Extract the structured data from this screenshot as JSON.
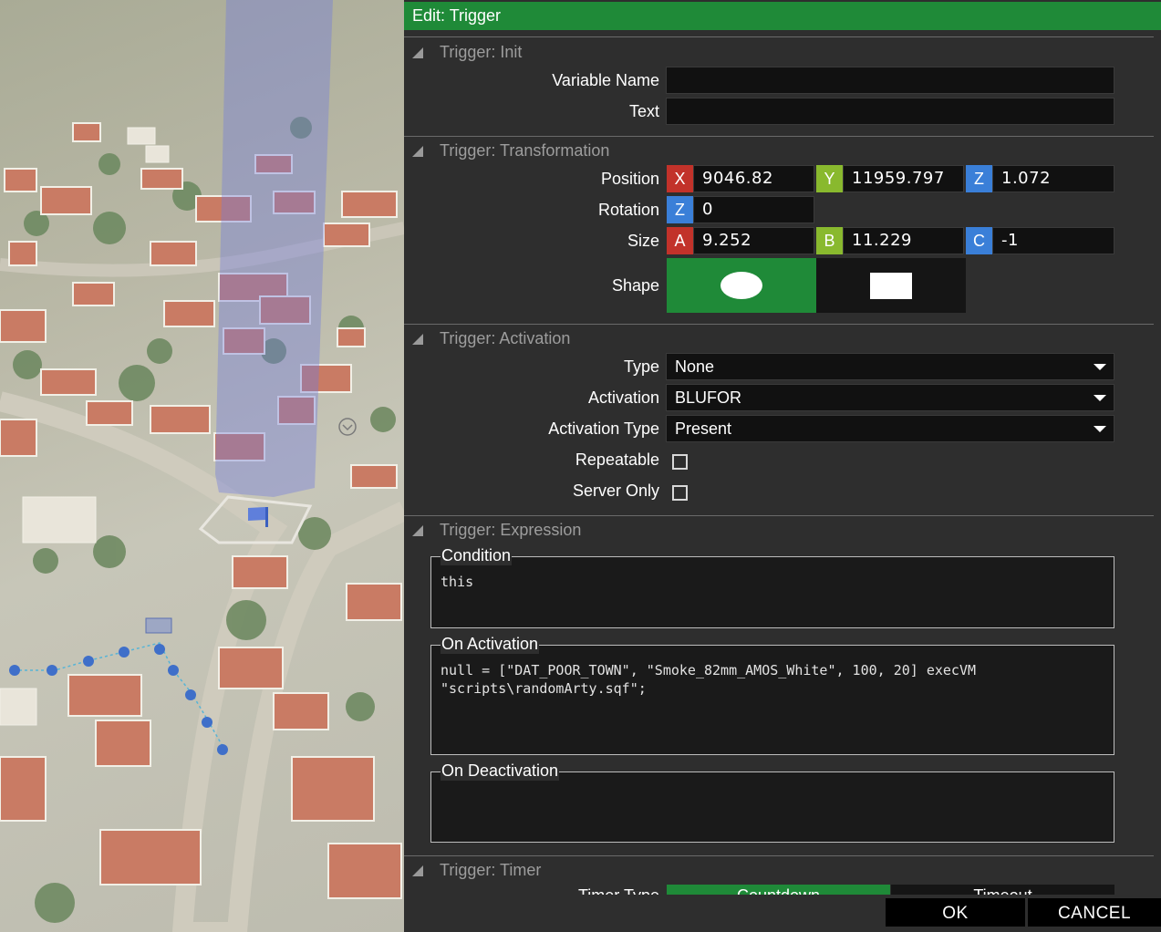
{
  "dialog": {
    "title": "Edit: Trigger"
  },
  "sections": {
    "init": {
      "title": "Trigger: Init",
      "variable_name_label": "Variable Name",
      "variable_name_value": "",
      "text_label": "Text",
      "text_value": ""
    },
    "transformation": {
      "title": "Trigger: Transformation",
      "position_label": "Position",
      "position": {
        "x_tag": "X",
        "x": "9046.82",
        "y_tag": "Y",
        "y": "11959.797",
        "z_tag": "Z",
        "z": "1.072"
      },
      "rotation_label": "Rotation",
      "rotation": {
        "z_tag": "Z",
        "z": "0"
      },
      "size_label": "Size",
      "size": {
        "a_tag": "A",
        "a": "9.252",
        "b_tag": "B",
        "b": "11.229",
        "c_tag": "C",
        "c": "-1"
      },
      "shape_label": "Shape",
      "shape_options": [
        "ellipse",
        "rectangle"
      ],
      "shape_selected": "ellipse"
    },
    "activation": {
      "title": "Trigger: Activation",
      "type_label": "Type",
      "type_value": "None",
      "activation_label": "Activation",
      "activation_value": "BLUFOR",
      "activation_type_label": "Activation Type",
      "activation_type_value": "Present",
      "repeatable_label": "Repeatable",
      "repeatable_checked": false,
      "server_only_label": "Server Only",
      "server_only_checked": false
    },
    "expression": {
      "title": "Trigger: Expression",
      "condition_label": "Condition",
      "condition_value": "this",
      "on_activation_label": "On Activation",
      "on_activation_value": "null = [\"DAT_POOR_TOWN\", \"Smoke_82mm_AMOS_White\", 100, 20] execVM\n\"scripts\\randomArty.sqf\";",
      "on_deactivation_label": "On Deactivation",
      "on_deactivation_value": ""
    },
    "timer": {
      "title": "Trigger: Timer",
      "timer_type_label": "Timer Type",
      "options": [
        "Countdown",
        "Timeout"
      ],
      "selected": "Countdown"
    }
  },
  "buttons": {
    "ok": "OK",
    "cancel": "CANCEL"
  },
  "colors": {
    "title_bar": "#1f8a38",
    "accent_green": "#1f8a38",
    "panel_bg": "#2e2e2e",
    "field_bg": "#111111",
    "x_tag": "#c2322a",
    "y_tag": "#89b92e",
    "z_tag": "#3a7fd8"
  },
  "icons": {
    "section_collapse": "triangle-collapse-icon",
    "dropdown": "chevron-down-icon",
    "map_flag": "flag-icon",
    "waypoint": "waypoint-icon"
  }
}
